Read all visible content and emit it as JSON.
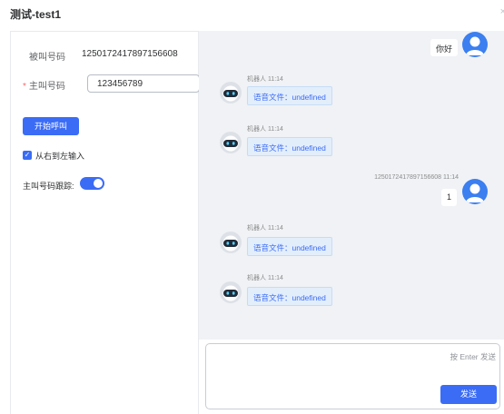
{
  "window": {
    "title": "测试-test1",
    "close_glyph": "×"
  },
  "form": {
    "callee_label": "被叫号码",
    "callee_value": "1250172417897156608",
    "caller_label": "主叫号码",
    "caller_required_mark": "*",
    "caller_value": "123456789",
    "start_call_label": "开始呼叫",
    "rtl_checkbox_checked": true,
    "rtl_checkbox_label": "从右到左输入",
    "caller_track_label": "主叫号码跟踪:",
    "caller_track_enabled": true
  },
  "chat": {
    "messages": [
      {
        "side": "right",
        "name": "",
        "time": "",
        "text": "你好"
      },
      {
        "side": "left",
        "name": "机器人",
        "time": "11:14",
        "text": "语音文件：undefined"
      },
      {
        "side": "left",
        "name": "机器人",
        "time": "11:14",
        "text": "语音文件：undefined"
      },
      {
        "side": "right",
        "name": "1250172417897156608",
        "time": "11:14",
        "text": "1"
      },
      {
        "side": "left",
        "name": "机器人",
        "time": "11:14",
        "text": "语音文件：undefined"
      },
      {
        "side": "left",
        "name": "机器人",
        "time": "11:14",
        "text": "语音文件：undefined"
      }
    ],
    "input_hint": "按 Enter 发送",
    "send_label": "发送"
  },
  "colors": {
    "primary": "#3b6cf6",
    "chat_background": "#f0f2f5",
    "bot_bubble": "#e3eefb",
    "user_avatar": "#3b7ff0"
  },
  "icons": {
    "bot_avatar": "robot-icon",
    "user_avatar": "user-icon",
    "checkbox": "check-icon",
    "close": "close-icon"
  }
}
